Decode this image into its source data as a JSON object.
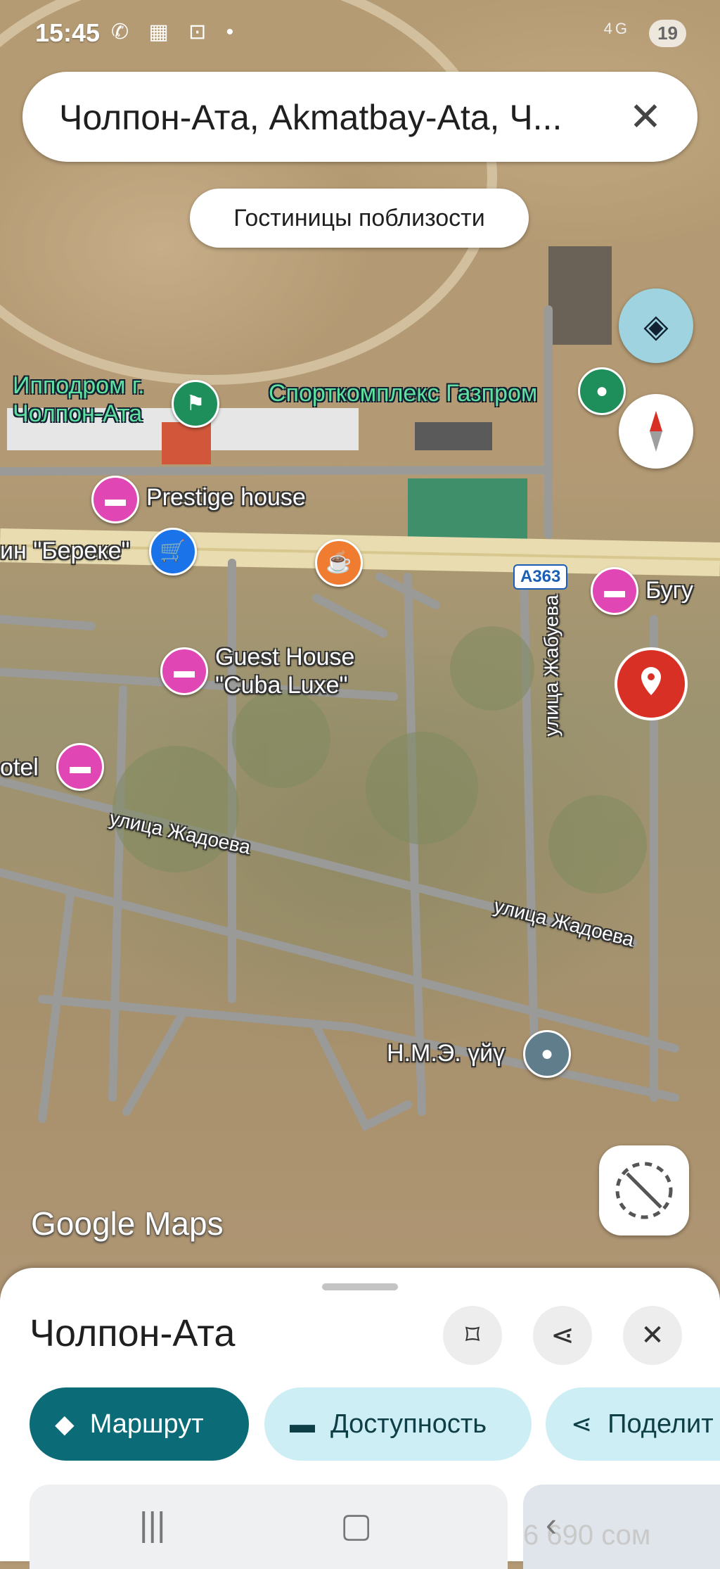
{
  "status_bar": {
    "time": "15:45",
    "icons": "✆ ▦ ⊡ •",
    "network": "4G",
    "battery": "19"
  },
  "search": {
    "value": "Чолпон-Ата, Akmatbay-Ata, Ч..."
  },
  "chips": {
    "nearby_hotels": "Гостиницы поблизости"
  },
  "map": {
    "labels": {
      "hippodrome": "Ипподром г.\nЧолпон-Ата",
      "sport": "Спорткомплекс Газпром",
      "prestige": "Prestige house",
      "bereke": "ин \"Береке\"",
      "bugu": "Бугу",
      "guesthouse": "Guest House\n\"Cuba Luxe\"",
      "otel": "otel",
      "street_jadoeva1": "улица Жадоева",
      "street_jadoeva2": "улица Жадоева",
      "street_jabueva": "улица Жабуева",
      "nme": "Н.М.Э. үйү",
      "road_shield": "A363"
    },
    "watermark": "Google Maps"
  },
  "place": {
    "title": "Чолпон-Ата",
    "actions": {
      "route": "Маршрут",
      "availability": "Доступность",
      "share": "Поделит"
    },
    "price": "6 690 сом"
  },
  "colors": {
    "primary": "#0b6b76",
    "secondary": "#cdeef4",
    "hotel_pin": "#e046b4",
    "red_pin": "#d93025"
  }
}
